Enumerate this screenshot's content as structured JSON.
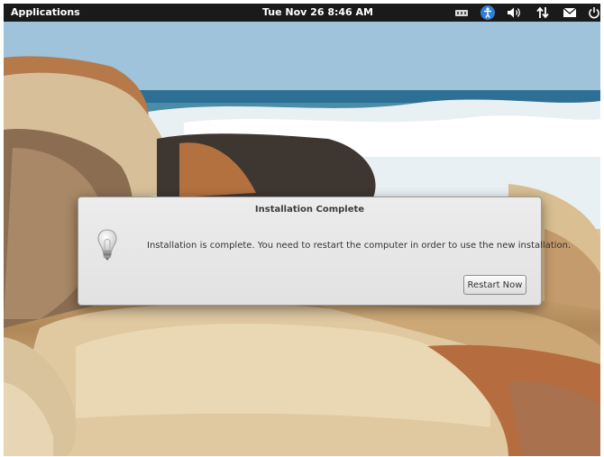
{
  "panel": {
    "applications_label": "Applications",
    "clock_text": "Tue Nov 26  8:46 AM",
    "indicators": [
      "network-wired-icon",
      "accessibility-icon",
      "volume-icon",
      "network-transfer-icon",
      "mail-icon",
      "power-icon"
    ]
  },
  "dialog": {
    "title": "Installation Complete",
    "message": "Installation is complete. You need to restart the computer in order to use the new installation.",
    "restart_label": "Restart Now",
    "icon": "lightbulb-icon"
  },
  "colors": {
    "panel_bg": "#1a1a1a",
    "dialog_bg": "#e6e6e6",
    "accessibility_accent": "#2f7fd6"
  }
}
